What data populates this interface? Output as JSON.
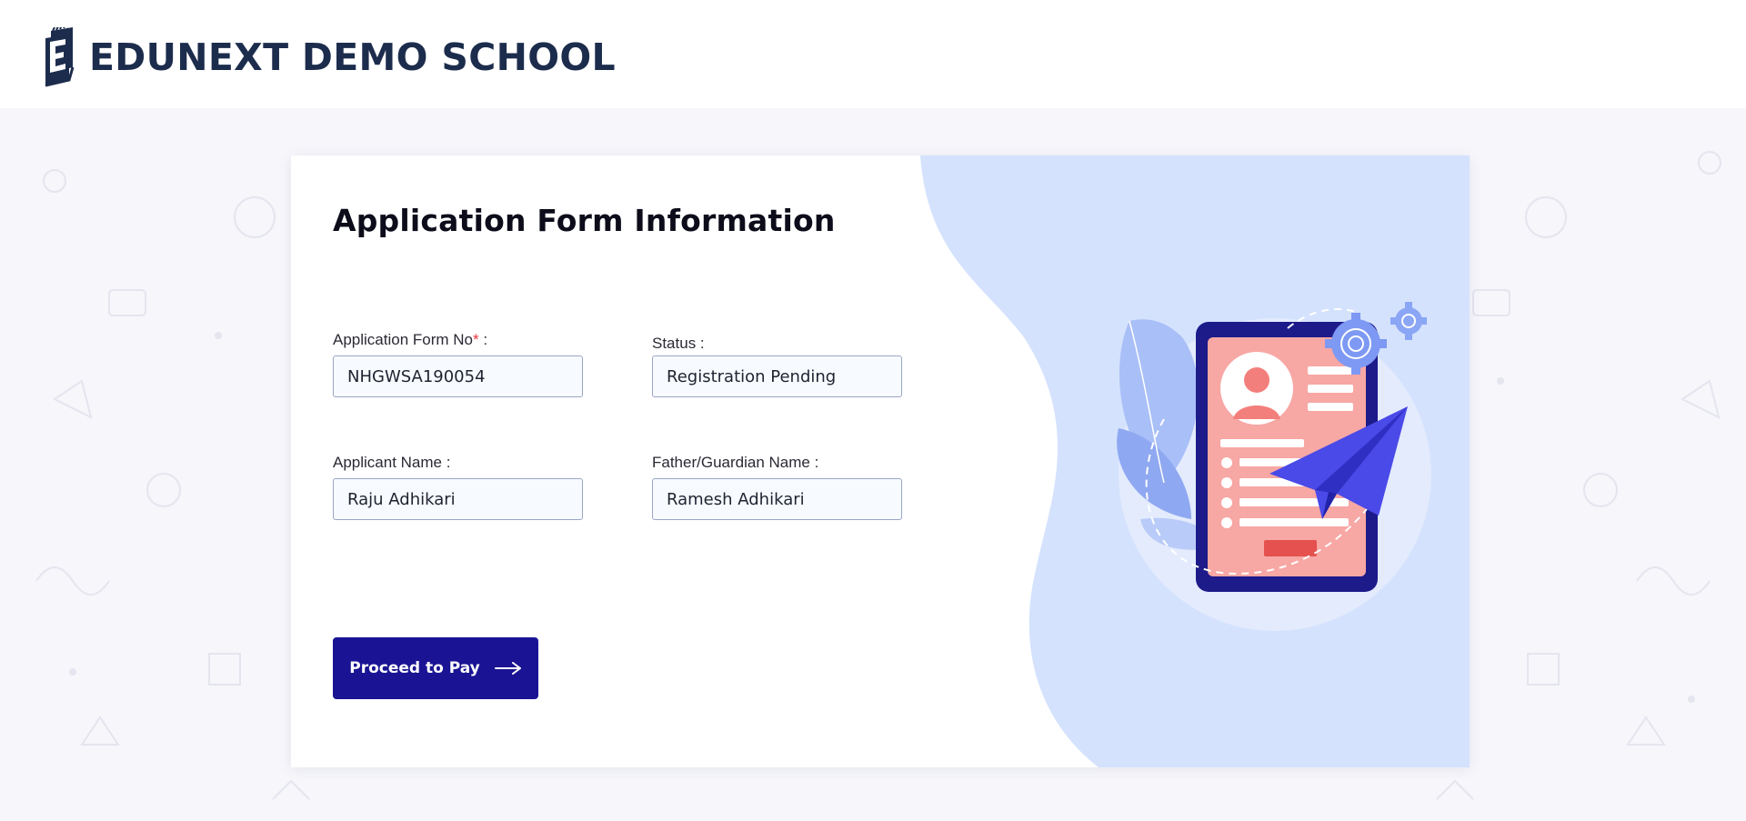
{
  "header": {
    "school_name": "EDUNEXT DEMO SCHOOL",
    "logo_icon": "book-logo-icon"
  },
  "form": {
    "title": "Application Form Information",
    "fields": {
      "application_form_no": {
        "label": "Application Form No",
        "required_mark": "*",
        "suffix": " :",
        "value": "NHGWSA190054"
      },
      "status": {
        "label": "Status :",
        "value": "Registration Pending"
      },
      "applicant_name": {
        "label": "Applicant Name :",
        "value": "Raju Adhikari"
      },
      "father_guardian_name": {
        "label": "Father/Guardian Name :",
        "value": "Ramesh Adhikari"
      }
    },
    "proceed_button": {
      "label": "Proceed to Pay",
      "icon": "arrow-right-icon"
    }
  },
  "illustration": {
    "icon": "application-form-illustration"
  },
  "colors": {
    "brand_navy": "#1c2c4c",
    "button": "#1a1494",
    "panel_blue": "#d4e2fd",
    "required": "#e5333d"
  }
}
